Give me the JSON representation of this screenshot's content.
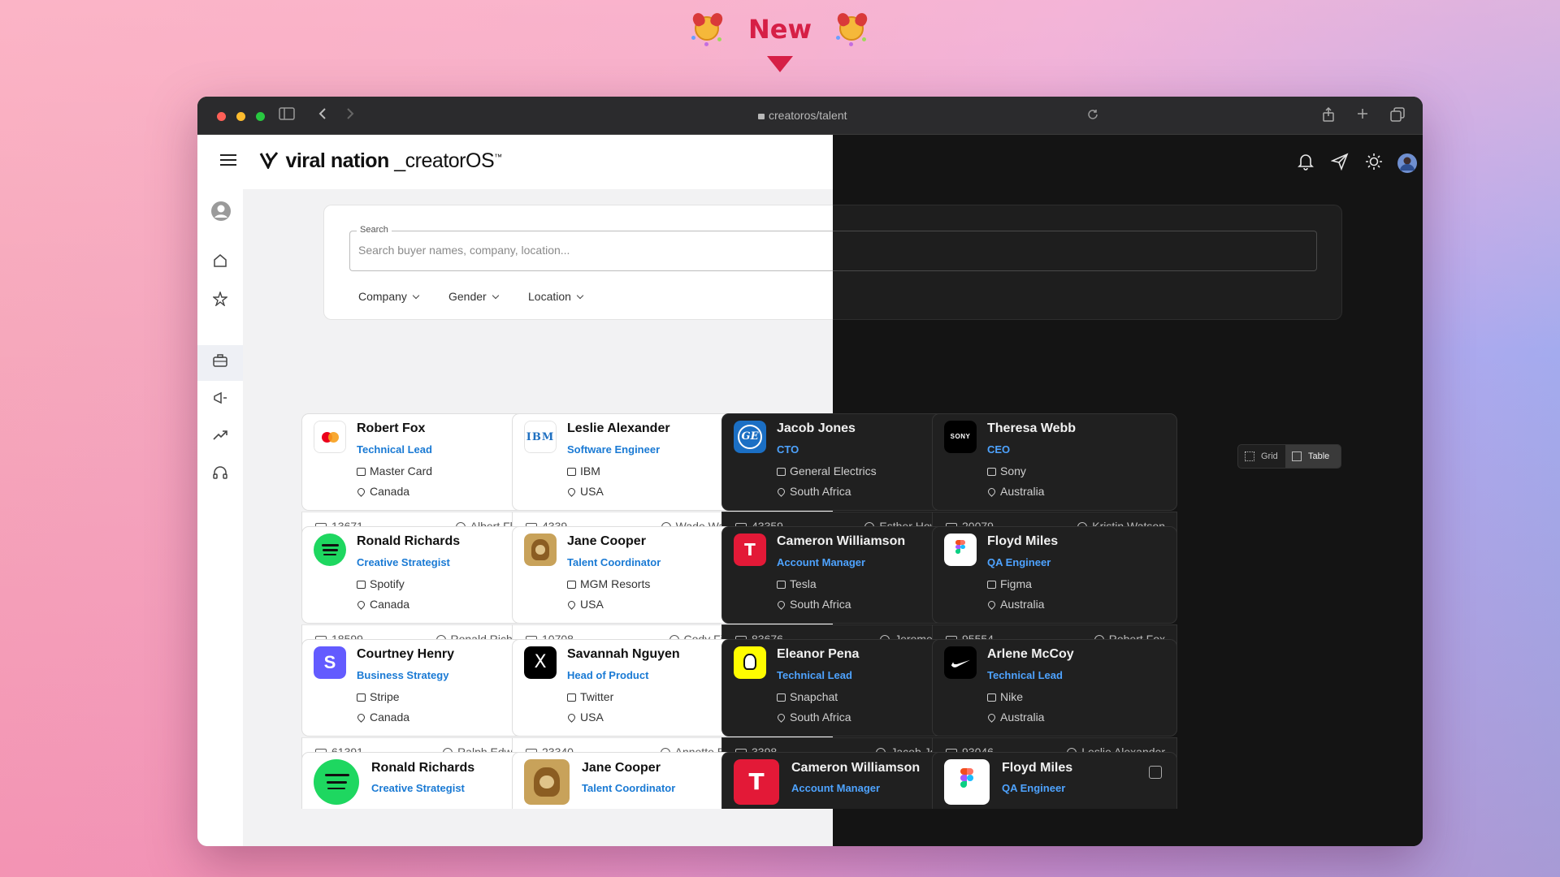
{
  "banner": {
    "title": "New"
  },
  "browser": {
    "url": "creatoros/talent"
  },
  "app": {
    "logo_brand": "viral nation",
    "logo_product": "_creatorOS",
    "logo_tm": "™"
  },
  "search": {
    "label": "Search",
    "placeholder": "Search buyer names, company, location..."
  },
  "filters": [
    "Company",
    "Gender",
    "Location"
  ],
  "view_toggle": {
    "grid": "Grid",
    "table": "Table",
    "active": "Table"
  },
  "cards": [
    {
      "name": "Robert Fox",
      "role": "Technical Lead",
      "company": "Master Card",
      "location": "Canada",
      "id": "13671",
      "owner": "Albert Flores",
      "logo": "mastercard-logo",
      "theme": "light"
    },
    {
      "name": "Leslie Alexander",
      "role": "Software Engineer",
      "company": "IBM",
      "location": "USA",
      "id": "4339",
      "owner": "Wade Warren",
      "logo": "ibm-logo",
      "theme": "light"
    },
    {
      "name": "Jacob Jones",
      "role": "CTO",
      "company": "General Electrics",
      "location": "South Africa",
      "id": "43359",
      "owner": "Esther Howard",
      "logo": "ge-logo",
      "theme": "dark"
    },
    {
      "name": "Theresa Webb",
      "role": "CEO",
      "company": "Sony",
      "location": "Australia",
      "id": "20079",
      "owner": "Kristin Watson",
      "logo": "sony-logo",
      "theme": "dark"
    },
    {
      "name": "Ronald Richards",
      "role": "Creative Strategist",
      "company": "Spotify",
      "location": "Canada",
      "id": "18599",
      "owner": "Ronald Richards",
      "logo": "spotify-logo",
      "theme": "light"
    },
    {
      "name": "Jane Cooper",
      "role": "Talent Coordinator",
      "company": "MGM Resorts",
      "location": "USA",
      "id": "10708",
      "owner": "Cody Fisher",
      "logo": "mgm-logo",
      "theme": "light"
    },
    {
      "name": "Cameron Williamson",
      "role": "Account Manager",
      "company": "Tesla",
      "location": "South Africa",
      "id": "83676",
      "owner": "Jerome Bell",
      "logo": "tesla-logo",
      "theme": "dark"
    },
    {
      "name": "Floyd Miles",
      "role": "QA Engineer",
      "company": "Figma",
      "location": "Australia",
      "id": "95554",
      "owner": "Robert Fox",
      "logo": "figma-logo",
      "theme": "dark"
    },
    {
      "name": "Courtney Henry",
      "role": "Business Strategy",
      "company": "Stripe",
      "location": "Canada",
      "id": "61391",
      "owner": "Ralph Edwards",
      "logo": "stripe-logo",
      "theme": "light"
    },
    {
      "name": "Savannah Nguyen",
      "role": "Head of Product",
      "company": "Twitter",
      "location": "USA",
      "id": "23340",
      "owner": "Annette Black",
      "logo": "x-logo",
      "theme": "light"
    },
    {
      "name": "Eleanor Pena",
      "role": "Technical Lead",
      "company": "Snapchat",
      "location": "South Africa",
      "id": "3398",
      "owner": "Jacob Jones",
      "logo": "snapchat-logo",
      "theme": "dark"
    },
    {
      "name": "Arlene McCoy",
      "role": "Technical Lead",
      "company": "Nike",
      "location": "Australia",
      "id": "93046",
      "owner": "Leslie Alexander",
      "logo": "nike-logo",
      "theme": "dark"
    }
  ],
  "partial_cards": [
    {
      "name": "Ronald Richards",
      "role": "Creative Strategist",
      "logo": "spotify-logo",
      "theme": "light"
    },
    {
      "name": "Jane Cooper",
      "role": "Talent Coordinator",
      "logo": "mgm-logo",
      "theme": "light"
    },
    {
      "name": "Cameron Williamson",
      "role": "Account Manager",
      "logo": "tesla-logo",
      "theme": "dark"
    },
    {
      "name": "Floyd Miles",
      "role": "QA Engineer",
      "logo": "figma-logo",
      "theme": "dark"
    }
  ],
  "colors": {
    "accent": "#1a7ad4",
    "banner": "#d61f46"
  }
}
